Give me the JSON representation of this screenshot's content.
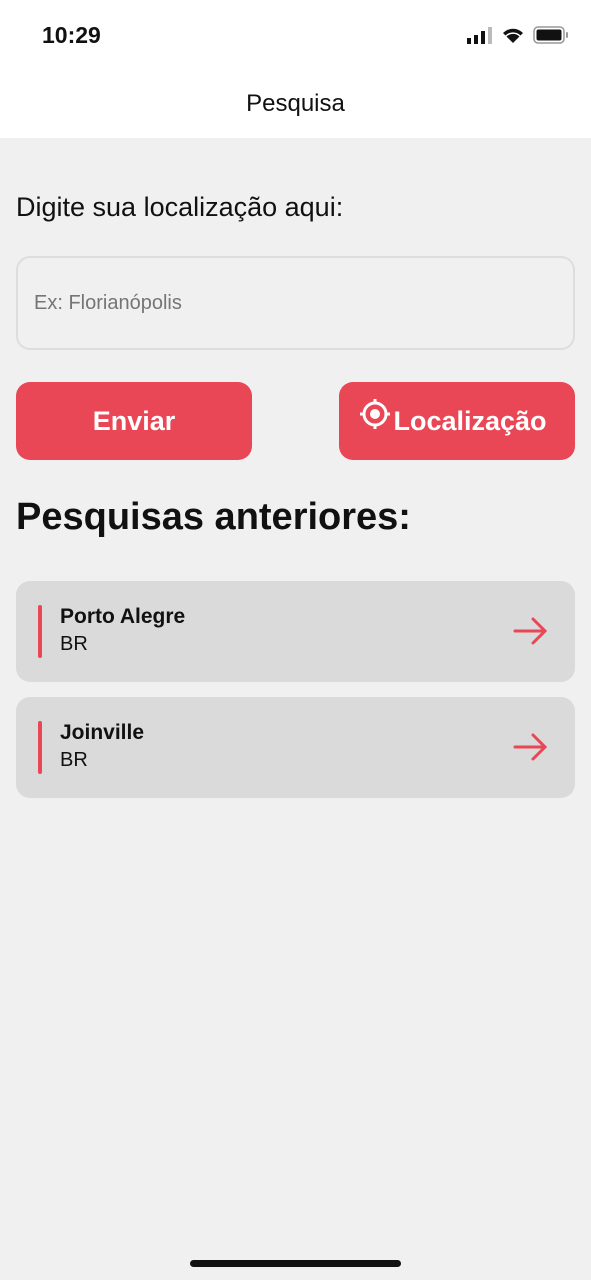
{
  "status_bar": {
    "time": "10:29"
  },
  "nav": {
    "title": "Pesquisa"
  },
  "search": {
    "label": "Digite sua localização aqui:",
    "placeholder": "Ex: Florianópolis",
    "value": ""
  },
  "buttons": {
    "send": "Enviar",
    "location": "Localização"
  },
  "history": {
    "title": "Pesquisas anteriores:",
    "items": [
      {
        "city": "Porto Alegre",
        "country": "BR"
      },
      {
        "city": "Joinville",
        "country": "BR"
      }
    ]
  },
  "colors": {
    "accent": "#e94755",
    "background": "#f0f0f0",
    "card": "#dadada"
  }
}
